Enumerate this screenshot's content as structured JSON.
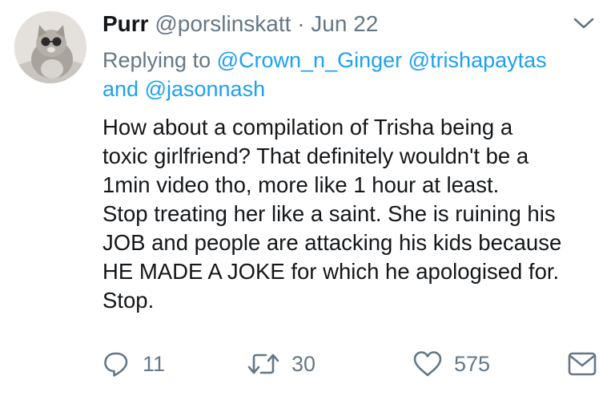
{
  "tweet": {
    "display_name": "Purr",
    "handle": "@porslinskatt",
    "separator": "·",
    "date": "Jun 22",
    "replying_prefix": "Replying to",
    "mentions": [
      "@Crown_n_Ginger",
      "@trishapaytas",
      "@jasonnash"
    ],
    "mentions_joiner": "and",
    "body_lines": [
      "How about a compilation of Trisha being a",
      "toxic girlfriend? That definitely wouldn't be a",
      "1min video tho, more like 1 hour at least.",
      "Stop treating her like a saint. She is ruining his",
      "JOB and people are attacking his kids because",
      "HE MADE A JOKE for which he apologised for.",
      "Stop."
    ]
  },
  "actions": {
    "reply_count": "11",
    "retweet_count": "30",
    "like_count": "575"
  },
  "icons": {
    "caret": "chevron-down-icon",
    "reply": "reply-icon",
    "retweet": "retweet-icon",
    "like": "heart-icon",
    "dm": "envelope-icon"
  },
  "colors": {
    "text": "#14171a",
    "secondary": "#657786",
    "link": "#1da1f2"
  }
}
